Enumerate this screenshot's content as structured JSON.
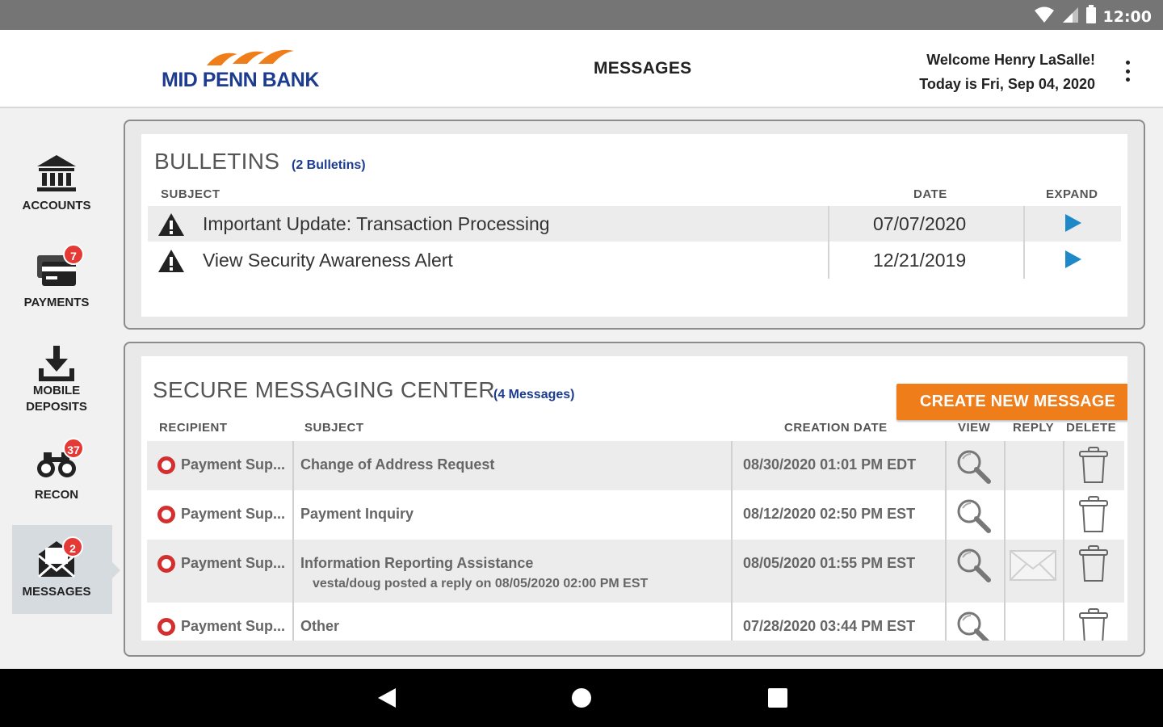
{
  "status_bar": {
    "time": "12:00",
    "icons": [
      "wifi-icon",
      "signal-icon",
      "battery-icon"
    ]
  },
  "header": {
    "logo_text": "MID PENN BANK",
    "page_title": "MESSAGES",
    "welcome_line": "Welcome Henry LaSalle!",
    "date_line": "Today is Fri, Sep 04, 2020"
  },
  "sidebar": {
    "items": [
      {
        "label_line1": "ACCOUNTS",
        "label_line2": "",
        "icon": "bank-icon",
        "badge": ""
      },
      {
        "label_line1": "PAYMENTS",
        "label_line2": "",
        "icon": "payments-icon",
        "badge": "7"
      },
      {
        "label_line1": "MOBILE",
        "label_line2": "DEPOSITS",
        "icon": "download-tray-icon",
        "badge": ""
      },
      {
        "label_line1": "RECON",
        "label_line2": "",
        "icon": "binoculars-icon",
        "badge": "37"
      },
      {
        "label_line1": "MESSAGES",
        "label_line2": "",
        "icon": "envelope-icon",
        "badge": "2"
      }
    ]
  },
  "bulletins": {
    "title": "BULLETINS",
    "count": "(2 Bulletins)",
    "columns": {
      "subject": "SUBJECT",
      "date": "DATE",
      "expand": "EXPAND"
    },
    "rows": [
      {
        "subject": "Important Update: Transaction Processing",
        "date": "07/07/2020"
      },
      {
        "subject": "View Security Awareness Alert",
        "date": "12/21/2019"
      }
    ]
  },
  "messaging": {
    "title": "SECURE MESSAGING CENTER",
    "count": "(4 Messages)",
    "create_button": "CREATE NEW MESSAGE",
    "columns": {
      "recipient": "RECIPIENT",
      "subject": "SUBJECT",
      "creation_date": "CREATION DATE",
      "view": "VIEW",
      "reply": "REPLY",
      "delete": "DELETE"
    },
    "rows": [
      {
        "recipient": "Payment Sup...",
        "subject": "Change of Address Request",
        "note": "",
        "date": "08/30/2020 01:01 PM EDT"
      },
      {
        "recipient": "Payment Sup...",
        "subject": "Payment Inquiry",
        "note": "",
        "date": "08/12/2020 02:50 PM EST"
      },
      {
        "recipient": "Payment Sup...",
        "subject": "Information Reporting Assistance",
        "note": "vesta/doug posted a reply on 08/05/2020 02:00 PM EST",
        "date": "08/05/2020 01:55 PM EST"
      },
      {
        "recipient": "Payment Sup...",
        "subject": "Other",
        "note": "",
        "date": "07/28/2020 03:44 PM EST"
      }
    ]
  },
  "colors": {
    "brand_blue": "#1d3c8f",
    "brand_orange": "#ef7d1a",
    "badge_red": "#e53935",
    "play_blue": "#1e88c8"
  }
}
